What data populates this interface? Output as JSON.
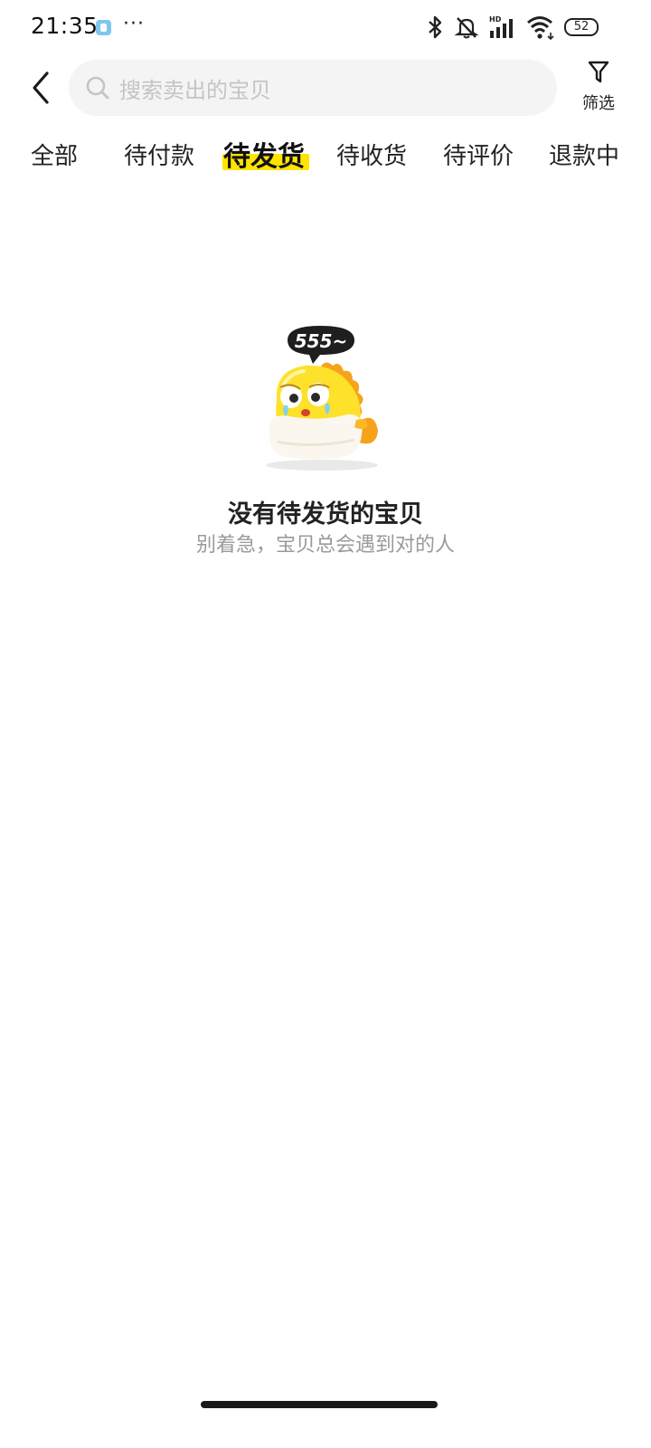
{
  "status_bar": {
    "time": "21:35",
    "more": "···",
    "battery": "52",
    "icons": [
      "bluetooth-icon",
      "mute-icon",
      "hd-signal-icon",
      "wifi-icon",
      "battery-icon"
    ]
  },
  "header": {
    "back_icon": "back-chevron-icon",
    "search_placeholder": "搜索卖出的宝贝",
    "filter_label": "筛选"
  },
  "tabs": [
    {
      "label": "全部",
      "active": false
    },
    {
      "label": "待付款",
      "active": false
    },
    {
      "label": "待发货",
      "active": true
    },
    {
      "label": "待收货",
      "active": false
    },
    {
      "label": "待评价",
      "active": false
    },
    {
      "label": "退款中",
      "active": false
    }
  ],
  "empty_state": {
    "illustration_icon": "crying-fish-mascot-icon",
    "bubble_text": "555~",
    "title": "没有待发货的宝贝",
    "subtitle": "别着急，宝贝总会遇到对的人"
  },
  "colors": {
    "accent_highlight": "#ffe400",
    "search_bg": "#f4f4f4",
    "subtitle_text": "#9a9a9a"
  }
}
